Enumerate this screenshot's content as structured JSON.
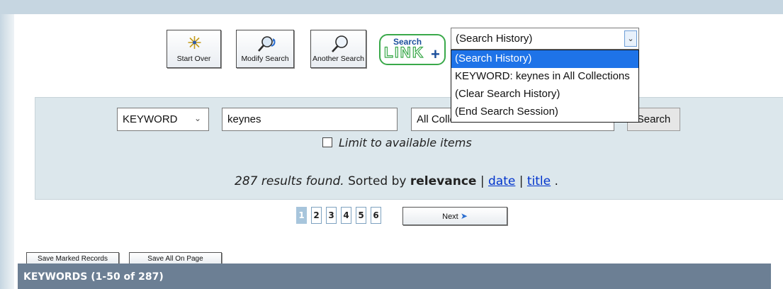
{
  "toolbar": {
    "start_over": "Start Over",
    "modify_search": "Modify Search",
    "another_search": "Another Search",
    "search_link": {
      "top": "Search",
      "bottom": "LINK",
      "plus": "+"
    }
  },
  "history": {
    "selected": "(Search History)",
    "options": [
      "(Search History)",
      "KEYWORD: keynes in All Collections",
      "(Clear Search History)",
      "(End Search Session)"
    ]
  },
  "search": {
    "field": "KEYWORD",
    "query": "keynes",
    "collection": "All Collections",
    "button": "Search",
    "limit_label": "Limit to available items"
  },
  "results": {
    "count_text": "287 results found.",
    "sorted_by": "Sorted by",
    "current_sort": "relevance",
    "sep": "|",
    "sort_date": "date",
    "sort_title": "title",
    "end": "."
  },
  "pagination": {
    "pages": [
      "1",
      "2",
      "3",
      "4",
      "5",
      "6"
    ],
    "current": "1",
    "next_label": "Next"
  },
  "actions": {
    "save_marked": "Save Marked Records",
    "save_all": "Save All On Page"
  },
  "list_header": "KEYWORDS (1-50 of 287)",
  "colors": {
    "panel_bg": "#dce7ec",
    "header_bg": "#6c7f94",
    "link": "#0033cc",
    "highlight": "#1e73e8",
    "search_link_green": "#3aa94a"
  }
}
